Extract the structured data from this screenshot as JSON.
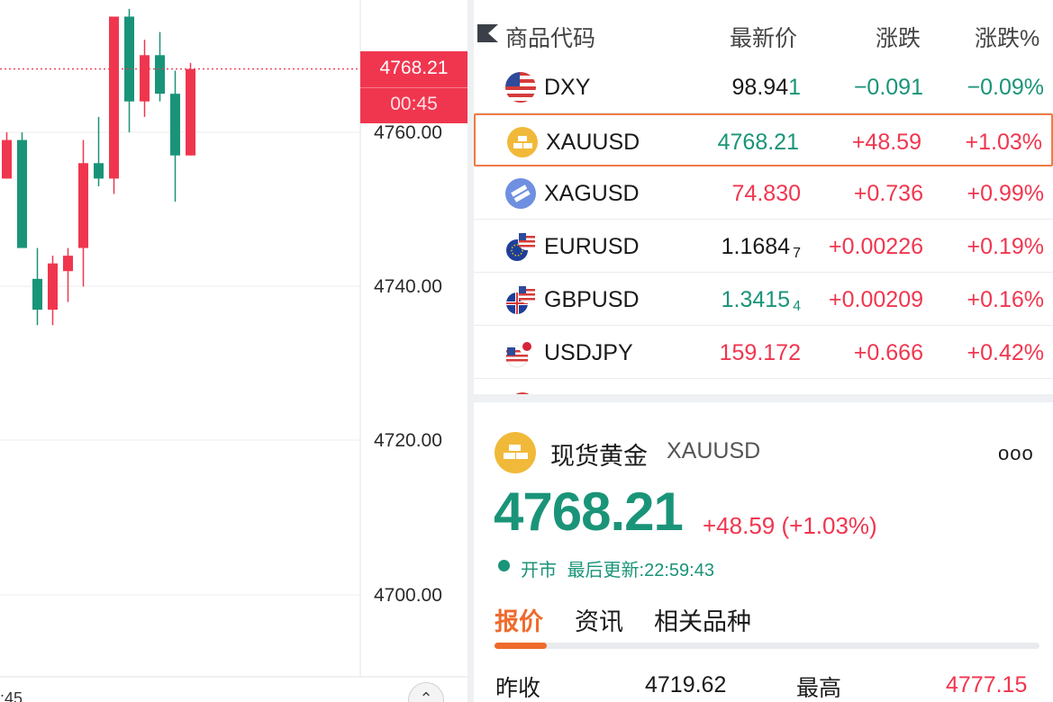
{
  "chart": {
    "price_ticks": [
      "4760.00",
      "4740.00",
      "4720.00",
      "4700.00"
    ],
    "current_price": "4768.21",
    "countdown": "00:45",
    "time_label": ":45",
    "up_color": "#f0364f",
    "down_color": "#1a9478",
    "candles": [
      {
        "o": 4759,
        "h": 4760,
        "l": 4754,
        "c": 4754,
        "dir": "up"
      },
      {
        "o": 4759,
        "h": 4760,
        "l": 4745,
        "c": 4745,
        "dir": "down"
      },
      {
        "o": 4741,
        "h": 4745,
        "l": 4735,
        "c": 4737,
        "dir": "down"
      },
      {
        "o": 4737,
        "h": 4744,
        "l": 4735,
        "c": 4743,
        "dir": "up"
      },
      {
        "o": 4742,
        "h": 4745,
        "l": 4738,
        "c": 4744,
        "dir": "up"
      },
      {
        "o": 4745,
        "h": 4759,
        "l": 4740,
        "c": 4756,
        "dir": "up"
      },
      {
        "o": 4756,
        "h": 4762,
        "l": 4753,
        "c": 4754,
        "dir": "down"
      },
      {
        "o": 4754,
        "h": 4775,
        "l": 4752,
        "c": 4775,
        "dir": "up"
      },
      {
        "o": 4775,
        "h": 4776,
        "l": 4760,
        "c": 4764,
        "dir": "down"
      },
      {
        "o": 4764,
        "h": 4772,
        "l": 4762,
        "c": 4770,
        "dir": "up"
      },
      {
        "o": 4770,
        "h": 4773,
        "l": 4764,
        "c": 4765,
        "dir": "down"
      },
      {
        "o": 4765,
        "h": 4768,
        "l": 4751,
        "c": 4757,
        "dir": "down"
      },
      {
        "o": 4757,
        "h": 4769,
        "l": 4757,
        "c": 4768.21,
        "dir": "up"
      }
    ]
  },
  "watchlist": {
    "headers": {
      "symbol": "商品代码",
      "last": "最新价",
      "change": "涨跌",
      "change_pct": "涨跌%"
    },
    "rows": [
      {
        "icon": "us-flag-icon",
        "symbol": "DXY",
        "last": "98.94",
        "last_suffix": "1",
        "last_sub": "",
        "change": "−0.091",
        "change_pct": "−0.09%",
        "last_color": "neutral",
        "change_color": "down"
      },
      {
        "icon": "gold-bars-icon",
        "symbol": "XAUUSD",
        "last": "4768.21",
        "last_suffix": "",
        "last_sub": "",
        "change": "+48.59",
        "change_pct": "+1.03%",
        "last_color": "down",
        "change_color": "up",
        "selected": true
      },
      {
        "icon": "silver-bars-icon",
        "symbol": "XAGUSD",
        "last": "74.830",
        "last_suffix": "",
        "last_sub": "",
        "change": "+0.736",
        "change_pct": "+0.99%",
        "last_color": "up",
        "change_color": "up"
      },
      {
        "icon": "eur-us-flags-icon",
        "symbol": "EURUSD",
        "last": "1.1684",
        "last_suffix": "",
        "last_sub": "7",
        "change": "+0.00226",
        "change_pct": "+0.19%",
        "last_color": "neutral",
        "change_color": "up"
      },
      {
        "icon": "gb-us-flags-icon",
        "symbol": "GBPUSD",
        "last": "1.3415",
        "last_suffix": "",
        "last_sub": "4",
        "change": "+0.00209",
        "change_pct": "+0.16%",
        "last_color": "down",
        "change_color": "up"
      },
      {
        "icon": "us-jp-flags-icon",
        "symbol": "USDJPY",
        "last": "159.172",
        "last_suffix": "",
        "last_sub": "",
        "change": "+0.666",
        "change_pct": "+0.42%",
        "last_color": "up",
        "change_color": "up"
      }
    ]
  },
  "detail": {
    "name": "现货黄金",
    "code": "XAUUSD",
    "price": "4768.21",
    "change": "+48.59 (+1.03%)",
    "status": "开市",
    "updated": "最后更新:22:59:43",
    "more": "ooo",
    "tabs": [
      "报价",
      "资讯",
      "相关品种"
    ],
    "quote": [
      {
        "label": "昨收",
        "value": "4719.62"
      },
      {
        "label": "最高",
        "value": "4777.15"
      }
    ]
  }
}
